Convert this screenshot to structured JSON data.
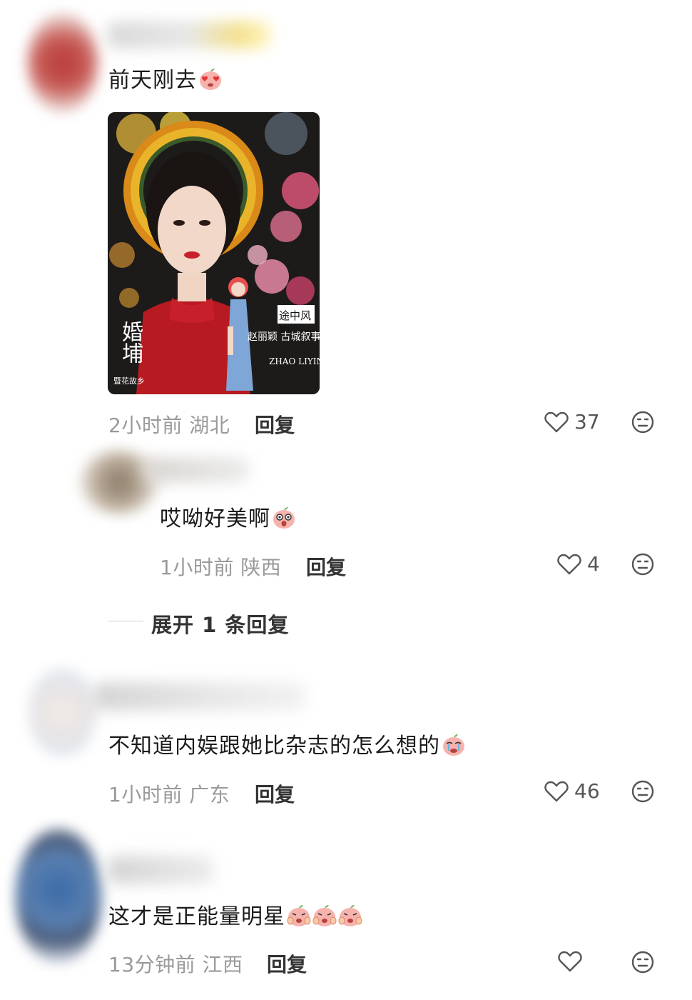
{
  "comments": [
    {
      "text": "前天刚去",
      "emoji": "heart-eyes-peach-emoji",
      "time": "2小时前",
      "location": "湖北",
      "reply_label": "回复",
      "likes": "37",
      "photo": {
        "title_vertical": "婚埔",
        "subtitle": "暨花故乡",
        "tag1": "途中风物",
        "tag2": "赵丽颖  古城叙事",
        "name_en": "ZHAO LIYING"
      }
    },
    {
      "text": "哎呦好美啊",
      "emoji": "surprised-peach-emoji",
      "time": "1小时前",
      "location": "陕西",
      "reply_label": "回复",
      "likes": "4"
    },
    {
      "text": "不知道内娱跟她比杂志的怎么想的",
      "emoji": "crying-peach-emoji",
      "time": "1小时前",
      "location": "广东",
      "reply_label": "回复",
      "likes": "46"
    },
    {
      "text": "这才是正能量明星",
      "emoji": "clapping-peach-emoji",
      "time": "13分钟前",
      "location": "江西",
      "reply_label": "回复",
      "likes": ""
    }
  ],
  "expand_replies": "展开 1 条回复",
  "colors": {
    "text": "#1b1b1b",
    "meta": "#9a9a9a",
    "icon": "#555555",
    "peach": "#f4a6a0"
  },
  "icons": [
    "heart-outline-icon",
    "dislike-face-icon"
  ]
}
